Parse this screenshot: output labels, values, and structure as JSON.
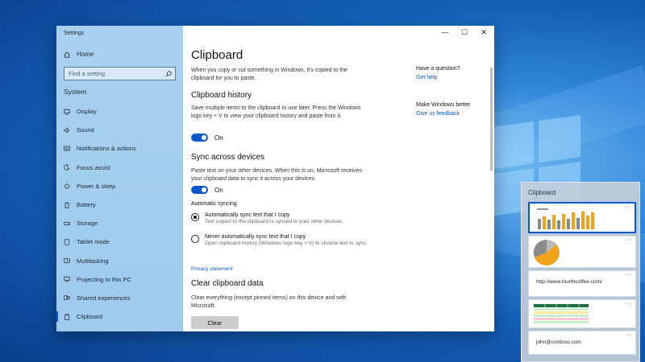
{
  "settings_window": {
    "app_title": "Settings",
    "controls": {
      "minimize": "—",
      "maximize": "☐",
      "close": "✕"
    },
    "sidebar": {
      "home": "Home",
      "search_placeholder": "Find a setting",
      "section": "System",
      "items": [
        {
          "label": "Display",
          "icon": "display-icon"
        },
        {
          "label": "Sound",
          "icon": "sound-icon"
        },
        {
          "label": "Notifications & actions",
          "icon": "notifications-icon"
        },
        {
          "label": "Focus assist",
          "icon": "focus-assist-icon"
        },
        {
          "label": "Power & sleep",
          "icon": "power-icon"
        },
        {
          "label": "Battery",
          "icon": "battery-icon"
        },
        {
          "label": "Storage",
          "icon": "storage-icon"
        },
        {
          "label": "Tablet mode",
          "icon": "tablet-icon"
        },
        {
          "label": "Multitasking",
          "icon": "multitasking-icon"
        },
        {
          "label": "Projecting to this PC",
          "icon": "projecting-icon"
        },
        {
          "label": "Shared experiences",
          "icon": "shared-experiences-icon"
        },
        {
          "label": "Clipboard",
          "icon": "clipboard-icon",
          "active": true
        }
      ]
    },
    "main": {
      "title": "Clipboard",
      "intro": "When you copy or cut something in Windows, it's copied to the clipboard for you to paste.",
      "history": {
        "heading": "Clipboard history",
        "description": "Save multiple items to the clipboard to use later. Press the Windows logo key + V to view your clipboard history and paste from it.",
        "toggle_label": "On"
      },
      "sync": {
        "heading": "Sync across devices",
        "description": "Paste text on your other devices. When this is on, Microsoft receives your clipboard data to sync it across your devices.",
        "toggle_label": "On",
        "auto_label": "Automatic syncing",
        "option1_title": "Automatically sync text that I copy",
        "option1_desc": "Text copied to the clipboard is synced to your other devices.",
        "option2_title": "Never automatically sync text that I copy",
        "option2_desc": "Open clipboard history (Windows logo key + V) to choose text to sync."
      },
      "privacy_link": "Privacy statement",
      "clear": {
        "heading": "Clear clipboard data",
        "description": "Clear everything (except pinned items) on this device and with Microsoft.",
        "button": "Clear"
      }
    },
    "aside": {
      "question": "Have a question?",
      "help_link": "Get help",
      "better": "Make Windows better",
      "feedback_link": "Give us feedback"
    }
  },
  "clipboard_flyout": {
    "title": "Clipboard",
    "more": "···",
    "items": [
      {
        "type": "image",
        "desc": "bar chart",
        "selected": true
      },
      {
        "type": "image",
        "desc": "pie chart"
      },
      {
        "type": "text",
        "text": "http://www.fourthcoffee.com/"
      },
      {
        "type": "image",
        "desc": "spreadsheet"
      },
      {
        "type": "text",
        "text": "john@contoso.com"
      }
    ]
  },
  "colors": {
    "accent": "#0a58c9",
    "sidebar": "#a9d1ef",
    "chart_bar": "#f0a21a",
    "chart_gray": "#8a8a8a"
  }
}
